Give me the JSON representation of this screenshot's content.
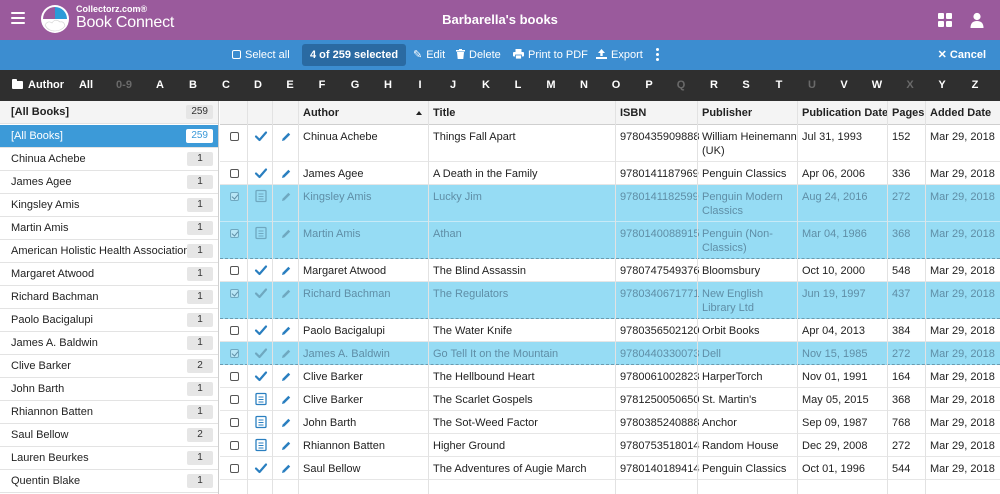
{
  "app": {
    "brand_small": "Collectorz.com®",
    "brand_name": "Book Connect",
    "window_title": "Barbarella's books"
  },
  "toolbar": {
    "select_all": "Select all",
    "selected_count": "4 of 259 selected",
    "edit": "Edit",
    "delete": "Delete",
    "print": "Print to PDF",
    "export": "Export",
    "cancel": "Cancel"
  },
  "alphabar": {
    "author_label": "Author",
    "letters": [
      {
        "t": "All",
        "dim": false
      },
      {
        "t": "0-9",
        "dim": true
      },
      {
        "t": "A",
        "dim": false
      },
      {
        "t": "B",
        "dim": false
      },
      {
        "t": "C",
        "dim": false
      },
      {
        "t": "D",
        "dim": false
      },
      {
        "t": "E",
        "dim": false
      },
      {
        "t": "F",
        "dim": false
      },
      {
        "t": "G",
        "dim": false
      },
      {
        "t": "H",
        "dim": false
      },
      {
        "t": "I",
        "dim": false
      },
      {
        "t": "J",
        "dim": false
      },
      {
        "t": "K",
        "dim": false
      },
      {
        "t": "L",
        "dim": false
      },
      {
        "t": "M",
        "dim": false
      },
      {
        "t": "N",
        "dim": false
      },
      {
        "t": "O",
        "dim": false
      },
      {
        "t": "P",
        "dim": false
      },
      {
        "t": "Q",
        "dim": true
      },
      {
        "t": "R",
        "dim": false
      },
      {
        "t": "S",
        "dim": false
      },
      {
        "t": "T",
        "dim": false
      },
      {
        "t": "U",
        "dim": true
      },
      {
        "t": "V",
        "dim": false
      },
      {
        "t": "W",
        "dim": false
      },
      {
        "t": "X",
        "dim": true
      },
      {
        "t": "Y",
        "dim": false
      },
      {
        "t": "Z",
        "dim": false
      }
    ]
  },
  "sidebar": {
    "header": {
      "label": "[All Books]",
      "count": "259"
    },
    "items": [
      {
        "label": "[All Books]",
        "count": "259",
        "active": true
      },
      {
        "label": "Chinua Achebe",
        "count": "1"
      },
      {
        "label": "James Agee",
        "count": "1"
      },
      {
        "label": "Kingsley Amis",
        "count": "1"
      },
      {
        "label": "Martin Amis",
        "count": "1"
      },
      {
        "label": "American Holistic Health Association",
        "count": "1"
      },
      {
        "label": "Margaret Atwood",
        "count": "1"
      },
      {
        "label": "Richard Bachman",
        "count": "1"
      },
      {
        "label": "Paolo Bacigalupi",
        "count": "1"
      },
      {
        "label": "James A. Baldwin",
        "count": "1"
      },
      {
        "label": "Clive Barker",
        "count": "2"
      },
      {
        "label": "John Barth",
        "count": "1"
      },
      {
        "label": "Rhiannon Batten",
        "count": "1"
      },
      {
        "label": "Saul Bellow",
        "count": "2"
      },
      {
        "label": "Lauren Beurkes",
        "count": "1"
      },
      {
        "label": "Quentin Blake",
        "count": "1"
      }
    ]
  },
  "table": {
    "columns": {
      "author": "Author",
      "title": "Title",
      "isbn": "ISBN",
      "publisher": "Publisher",
      "pubdate": "Publication Date",
      "pages": "Pages",
      "added": "Added Date"
    },
    "rows": [
      {
        "author": "Chinua Achebe",
        "title": "Things Fall Apart",
        "isbn": "9780435909888",
        "publisher": "William Heinemann (UK)",
        "pubdate": "Jul 31, 1993",
        "pages": "152",
        "added": "Mar 29, 2018",
        "status": "check",
        "selected": false,
        "tall": true
      },
      {
        "author": "James Agee",
        "title": "A Death in the Family",
        "isbn": "9780141187969",
        "publisher": "Penguin Classics",
        "pubdate": "Apr 06, 2006",
        "pages": "336",
        "added": "Mar 29, 2018",
        "status": "check",
        "selected": false,
        "tall": false
      },
      {
        "author": "Kingsley Amis",
        "title": "Lucky Jim",
        "isbn": "9780141182599",
        "publisher": "Penguin Modern Classics",
        "pubdate": "Aug 24, 2016",
        "pages": "272",
        "added": "Mar 29, 2018",
        "status": "book",
        "selected": true,
        "tall": true
      },
      {
        "author": "Martin Amis",
        "title": "Athan",
        "isbn": "9780140088915",
        "publisher": "Penguin (Non-Classics)",
        "pubdate": "Mar 04, 1986",
        "pages": "368",
        "added": "Mar 29, 2018",
        "status": "book",
        "selected": true,
        "tall": true
      },
      {
        "author": "Margaret Atwood",
        "title": "The Blind Assassin",
        "isbn": "9780747549376",
        "publisher": "Bloomsbury",
        "pubdate": "Oct 10, 2000",
        "pages": "548",
        "added": "Mar 29, 2018",
        "status": "check",
        "selected": false,
        "tall": false
      },
      {
        "author": "Richard Bachman",
        "title": "The Regulators",
        "isbn": "9780340671771",
        "publisher": "New English Library Ltd",
        "pubdate": "Jun 19, 1997",
        "pages": "437",
        "added": "Mar 29, 2018",
        "status": "check",
        "selected": true,
        "tall": true
      },
      {
        "author": "Paolo Bacigalupi",
        "title": "The Water Knife",
        "isbn": "9780356502120",
        "publisher": "Orbit Books",
        "pubdate": "Apr 04, 2013",
        "pages": "384",
        "added": "Mar 29, 2018",
        "status": "check",
        "selected": false,
        "tall": false
      },
      {
        "author": "James A. Baldwin",
        "title": "Go Tell It on the Mountain",
        "isbn": "9780440330073",
        "publisher": "Dell",
        "pubdate": "Nov 15, 1985",
        "pages": "272",
        "added": "Mar 29, 2018",
        "status": "check",
        "selected": true,
        "tall": false
      },
      {
        "author": "Clive Barker",
        "title": "The Hellbound Heart",
        "isbn": "9780061002823",
        "publisher": "HarperTorch",
        "pubdate": "Nov 01, 1991",
        "pages": "164",
        "added": "Mar 29, 2018",
        "status": "check",
        "selected": false,
        "tall": false
      },
      {
        "author": "Clive Barker",
        "title": "The Scarlet Gospels",
        "isbn": "9781250050650",
        "publisher": "St. Martin's",
        "pubdate": "May 05, 2015",
        "pages": "368",
        "added": "Mar 29, 2018",
        "status": "book",
        "selected": false,
        "tall": false
      },
      {
        "author": "John Barth",
        "title": "The Sot-Weed Factor",
        "isbn": "9780385240888",
        "publisher": "Anchor",
        "pubdate": "Sep 09, 1987",
        "pages": "768",
        "added": "Mar 29, 2018",
        "status": "book",
        "selected": false,
        "tall": false
      },
      {
        "author": "Rhiannon Batten",
        "title": "Higher Ground",
        "isbn": "9780753518014",
        "publisher": "Random House",
        "pubdate": "Dec 29, 2008",
        "pages": "272",
        "added": "Mar 29, 2018",
        "status": "book",
        "selected": false,
        "tall": false
      },
      {
        "author": "Saul Bellow",
        "title": "The Adventures of Augie March",
        "isbn": "9780140189414",
        "publisher": "Penguin Classics",
        "pubdate": "Oct 01, 1996",
        "pages": "544",
        "added": "Mar 29, 2018",
        "status": "check",
        "selected": false,
        "tall": false
      }
    ]
  },
  "colors": {
    "titlebar": "#9a5a9c",
    "toolbar": "#3c8dd0",
    "alphabar": "#2f2f2f",
    "selected_row": "#96dcf4",
    "status_icon": "#2a7fc0"
  },
  "icons": {
    "menu": "hamburger-icon",
    "logo": "collectorz-logo",
    "view": "grid-view-icon",
    "account": "user-icon",
    "status_owned": "check-icon",
    "status_wishlist": "book-icon",
    "edit_row": "pencil-icon"
  }
}
